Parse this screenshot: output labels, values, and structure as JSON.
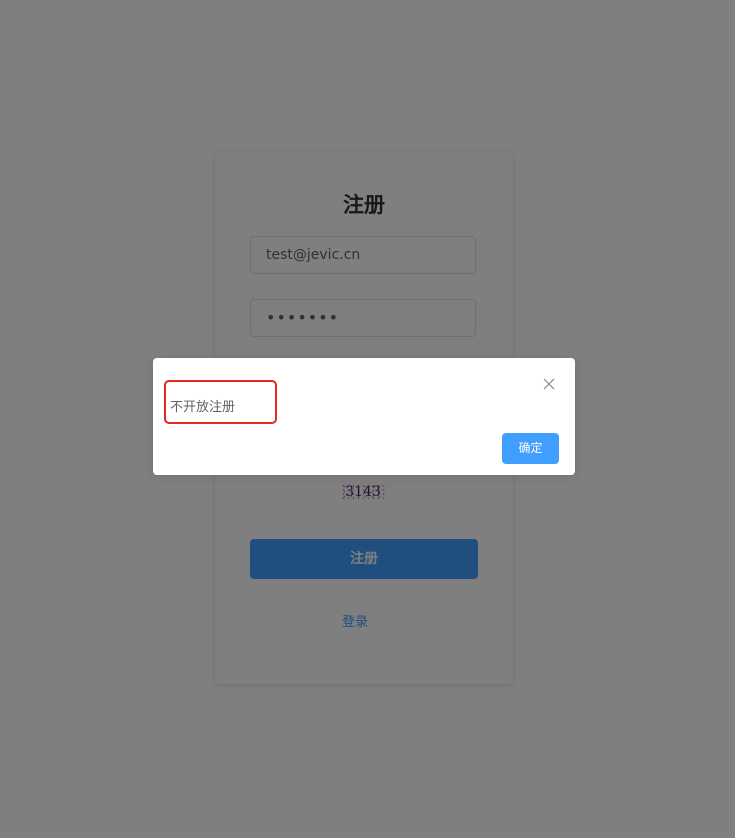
{
  "register_form": {
    "title": "注册",
    "email_value": "test@jevic.cn",
    "password_value": "•••••••",
    "captcha_text": "3143",
    "register_button": "注册",
    "login_link": "登录"
  },
  "message_box": {
    "message": "不开放注册",
    "confirm_button": "确定",
    "close_icon": "close-icon"
  },
  "colors": {
    "primary": "#409eff",
    "highlight": "#e3281c",
    "overlay": "rgba(0,0,0,0.5)"
  }
}
